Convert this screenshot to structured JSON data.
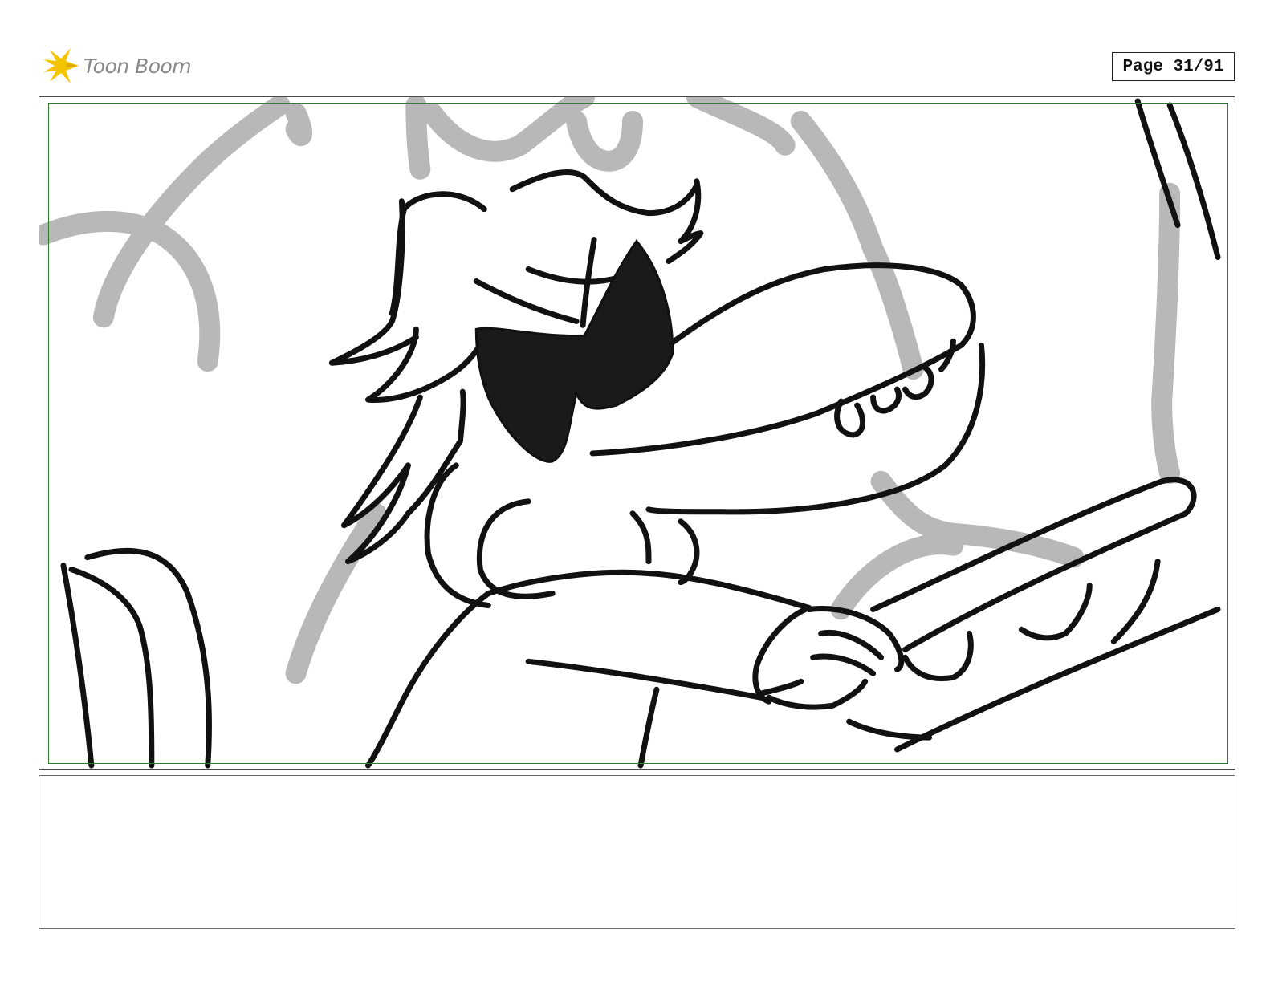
{
  "header": {
    "logo_text": "Toon Boom",
    "logo_icon": "starburst-icon",
    "page_label": "Page 31/91"
  },
  "panel": {
    "image_subject": "storyboard-sketch-character-with-sunglasses",
    "safe_frame_color": "#2e7d32",
    "background_sketch_color": "#b8b8b8",
    "line_color": "#111111"
  },
  "caption": {
    "text": ""
  },
  "colors": {
    "logo_accent": "#f5c400",
    "logo_text": "#8a8a8a"
  }
}
